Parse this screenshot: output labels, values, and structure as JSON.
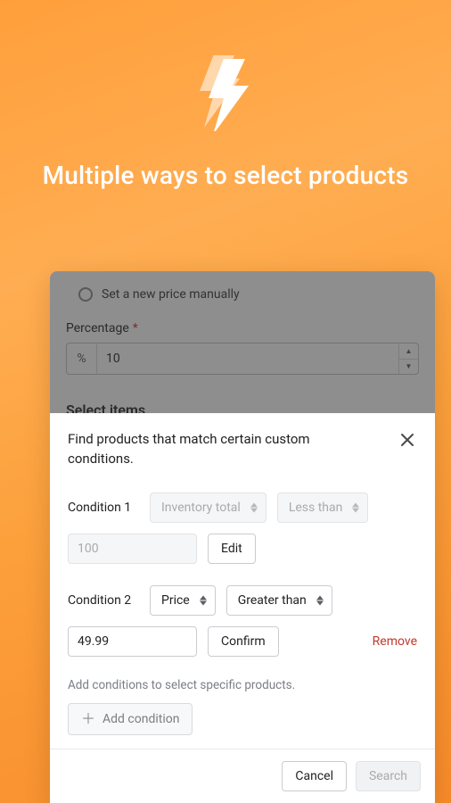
{
  "hero": {
    "title": "Multiple ways to select products"
  },
  "underlay": {
    "radio_label": "Set a new price manually",
    "percentage_label": "Percentage",
    "required_mark": "*",
    "percent_prefix": "%",
    "percent_value": "10",
    "select_items_title": "Select items"
  },
  "modal": {
    "title": "Find products that match certain custom conditions.",
    "condition1": {
      "label": "Condition 1",
      "field": "Inventory total",
      "operator": "Less than",
      "value": "100",
      "edit_label": "Edit"
    },
    "condition2": {
      "label": "Condition 2",
      "field": "Price",
      "operator": "Greater than",
      "value": "49.99",
      "confirm_label": "Confirm",
      "remove_label": "Remove"
    },
    "helper_text": "Add conditions to select specific products.",
    "add_condition_label": "Add condition",
    "cancel_label": "Cancel",
    "search_label": "Search"
  }
}
